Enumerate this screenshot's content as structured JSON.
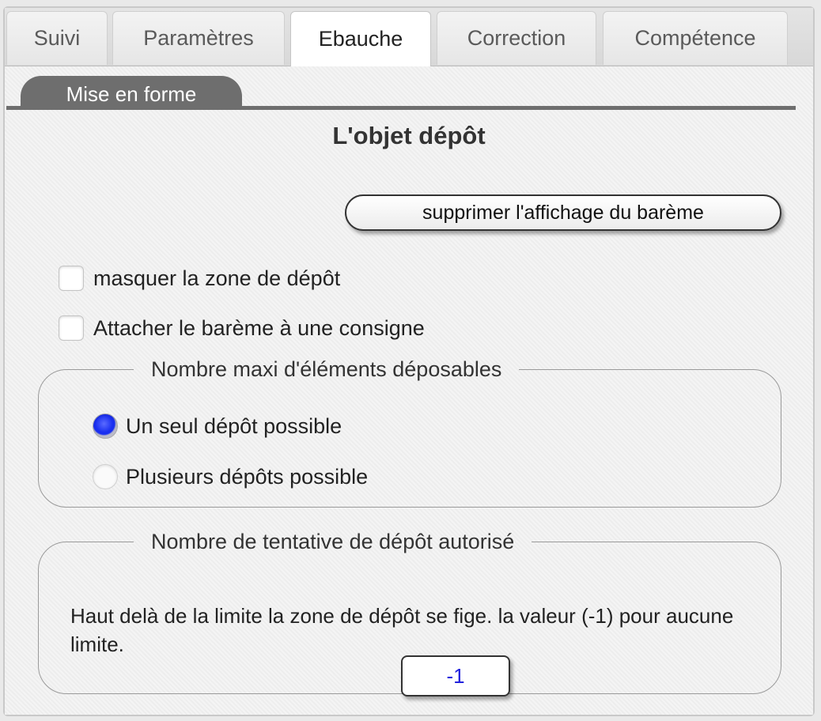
{
  "tabs": [
    {
      "label": "Suivi",
      "active": false
    },
    {
      "label": "Paramètres",
      "active": false
    },
    {
      "label": "Ebauche",
      "active": true
    },
    {
      "label": "Correction",
      "active": false
    },
    {
      "label": "Compétence",
      "active": false
    }
  ],
  "subtab": {
    "label": "Mise en forme"
  },
  "heading": "L'objet dépôt",
  "remove_scale_button": "supprimer l'affichage du barème",
  "checkboxes": {
    "hide_drop_zone": {
      "label": "masquer la zone de dépôt",
      "checked": false
    },
    "attach_scale": {
      "label": "Attacher le barème à une consigne",
      "checked": false
    }
  },
  "max_items_group": {
    "legend": "Nombre maxi d'éléments déposables",
    "options": [
      {
        "label": "Un seul dépôt possible",
        "checked": true
      },
      {
        "label": "Plusieurs dépôts possible",
        "checked": false
      }
    ]
  },
  "attempts_group": {
    "legend": "Nombre de tentative de dépôt autorisé",
    "description": "Haut delà de la limite la zone de dépôt se fige. la valeur (-1) pour aucune limite.",
    "value": "-1"
  },
  "colors": {
    "accent_radio": "#1a2ff0",
    "input_text": "#2222dd",
    "subtab_bg": "#6e6e6e"
  }
}
